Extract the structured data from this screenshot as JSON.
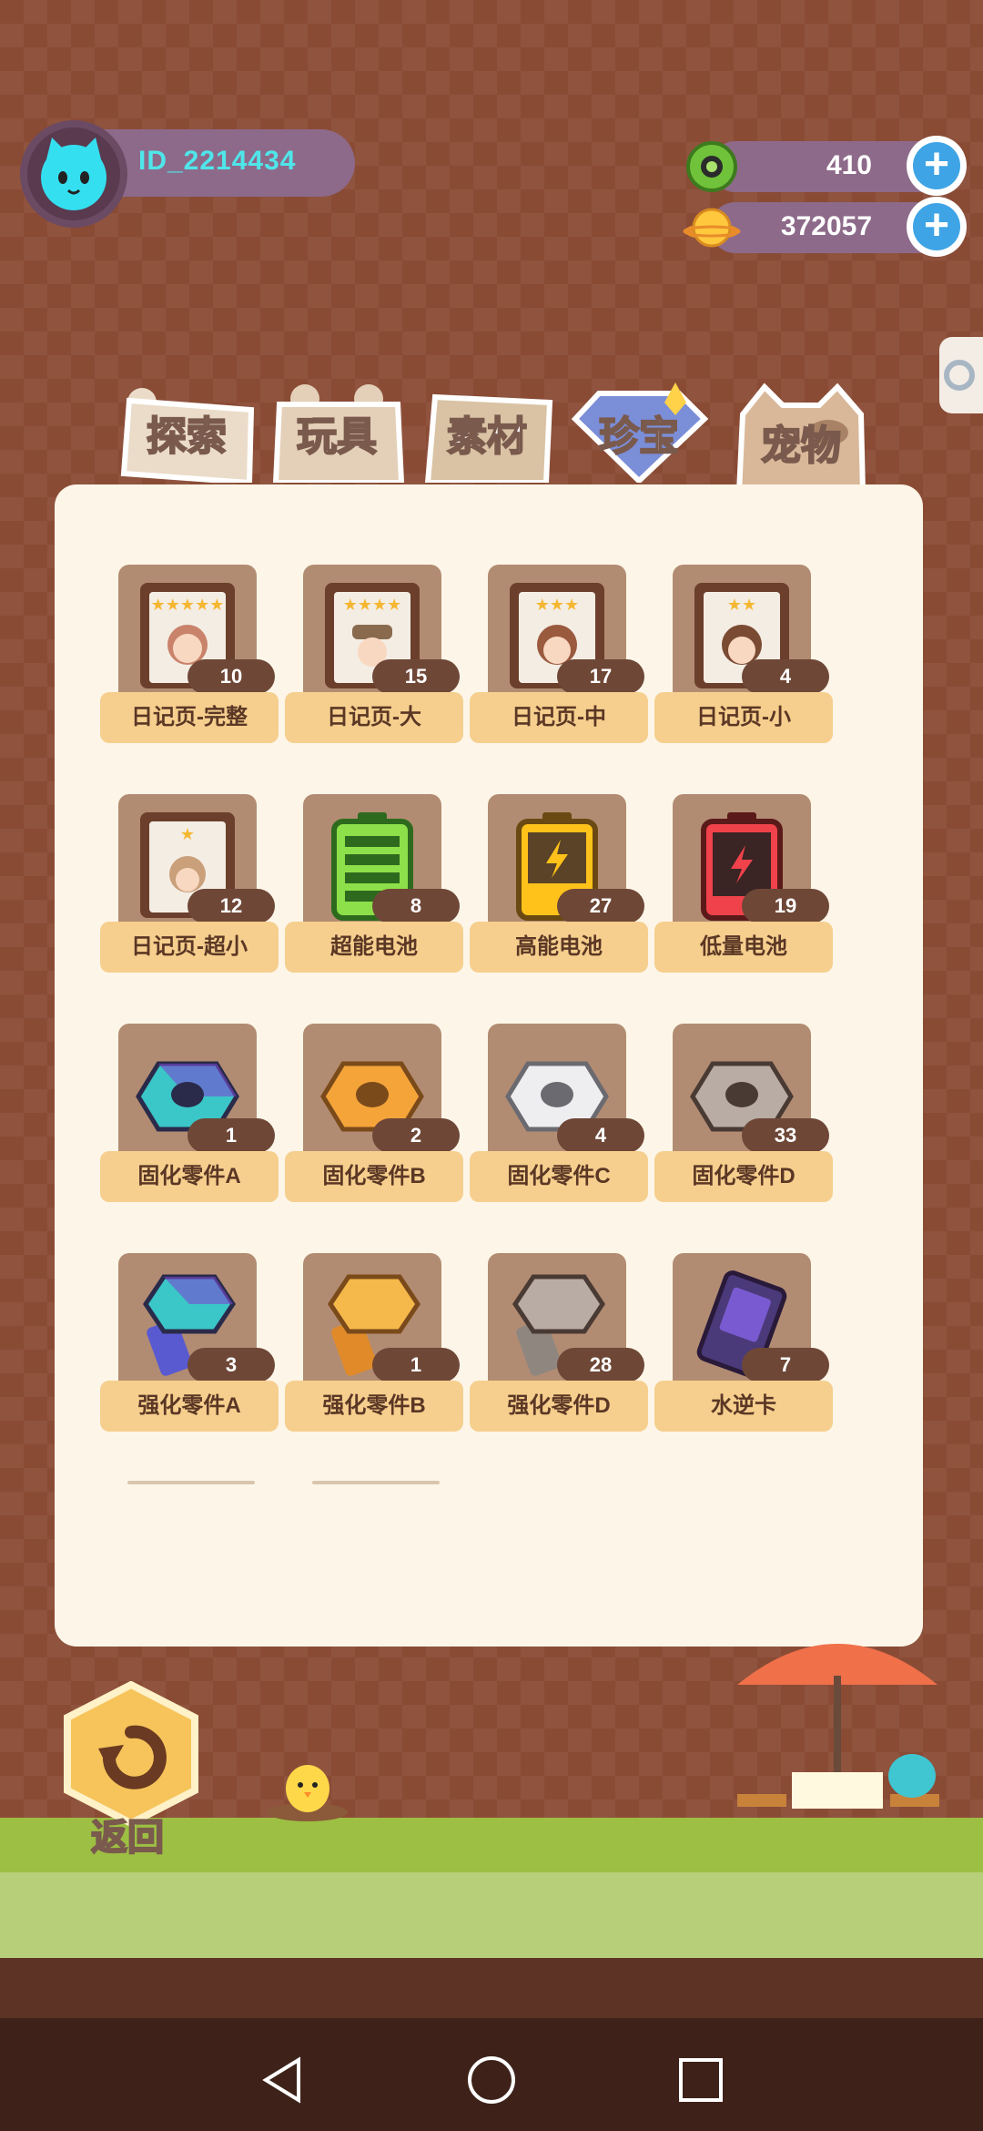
{
  "user": {
    "id": "ID_2214434"
  },
  "currencies": [
    {
      "name": "gem-currency",
      "value": "410"
    },
    {
      "name": "coin-currency",
      "value": "372057"
    }
  ],
  "tabs": [
    "探索",
    "玩具",
    "素材",
    "珍宝",
    "宠物"
  ],
  "items": [
    {
      "label": "日记页-完整",
      "count": "10",
      "icon": "diary-page-icon",
      "stars": 5
    },
    {
      "label": "日记页-大",
      "count": "15",
      "icon": "diary-page-icon",
      "stars": 4
    },
    {
      "label": "日记页-中",
      "count": "17",
      "icon": "diary-page-icon",
      "stars": 3
    },
    {
      "label": "日记页-小",
      "count": "4",
      "icon": "diary-page-icon",
      "stars": 2
    },
    {
      "label": "日记页-超小",
      "count": "12",
      "icon": "diary-page-icon",
      "stars": 1
    },
    {
      "label": "超能电池",
      "count": "8",
      "icon": "battery-green-icon"
    },
    {
      "label": "高能电池",
      "count": "27",
      "icon": "battery-yellow-icon"
    },
    {
      "label": "低量电池",
      "count": "19",
      "icon": "battery-red-icon"
    },
    {
      "label": "固化零件A",
      "count": "1",
      "icon": "nut-iridescent-icon"
    },
    {
      "label": "固化零件B",
      "count": "2",
      "icon": "nut-gold-icon"
    },
    {
      "label": "固化零件C",
      "count": "4",
      "icon": "nut-white-icon"
    },
    {
      "label": "固化零件D",
      "count": "33",
      "icon": "nut-grey-icon"
    },
    {
      "label": "强化零件A",
      "count": "3",
      "icon": "bolt-iridescent-icon"
    },
    {
      "label": "强化零件B",
      "count": "1",
      "icon": "bolt-gold-icon"
    },
    {
      "label": "强化零件D",
      "count": "28",
      "icon": "bolt-grey-icon"
    },
    {
      "label": "水逆卡",
      "count": "7",
      "icon": "card-icon"
    }
  ],
  "back_label": "返回",
  "colors": {
    "background": "#8a4b35",
    "panel": "#fdf6e8",
    "label_bg": "#f6cf8e",
    "accent_cyan": "#4fe6ea",
    "plus_blue": "#3ea4e5"
  }
}
